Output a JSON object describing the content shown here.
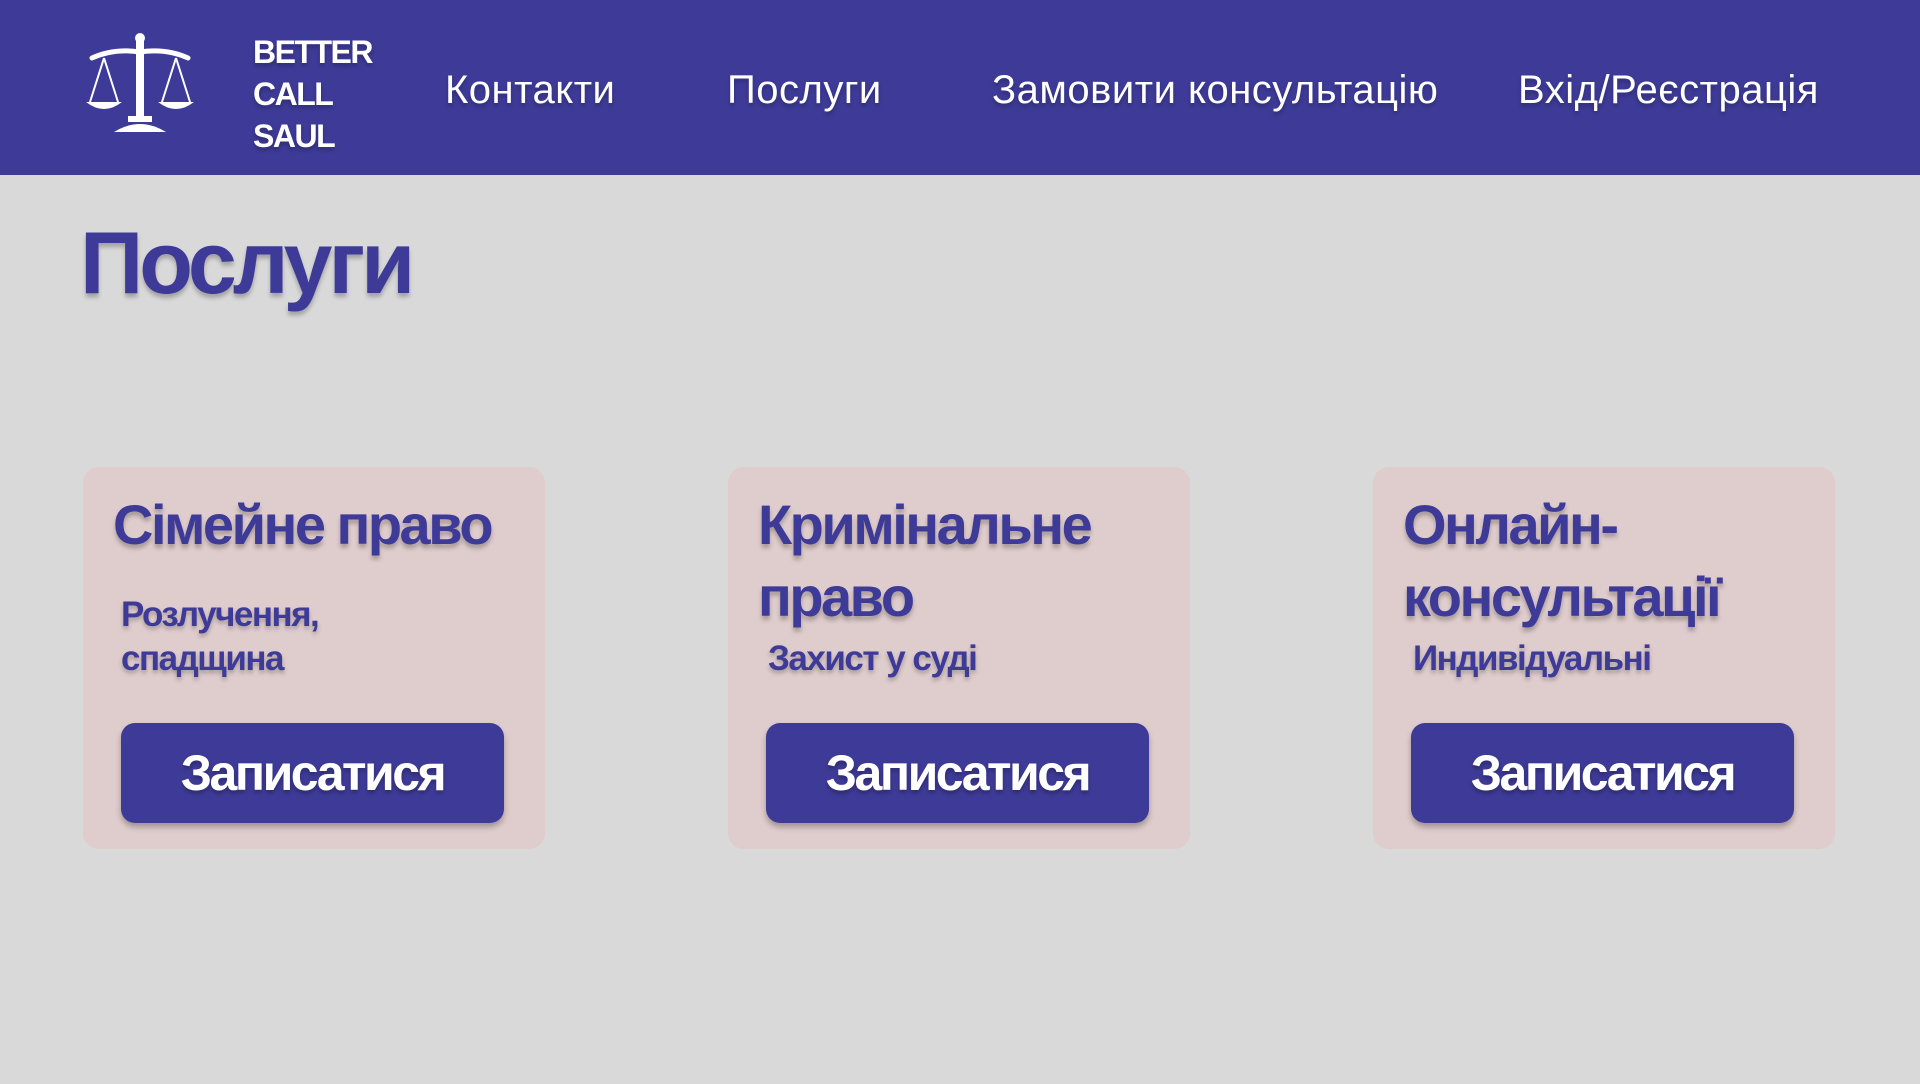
{
  "brand": {
    "lines": [
      "BETTER",
      "CALL",
      "SAUL"
    ],
    "logo_icon": "scales-of-justice-icon"
  },
  "nav": {
    "contacts": "Контакти",
    "services": "Послуги",
    "order_consultation": "Замовити консультацію",
    "login_register": "Вхід/Реєстрація"
  },
  "page": {
    "title": "Послуги"
  },
  "cards": [
    {
      "title_lines": [
        "Сімейне право"
      ],
      "description_lines": [
        "Розлучення,",
        "спадщина"
      ],
      "button_label": "Записатися"
    },
    {
      "title_lines": [
        "Кримінальне",
        "право"
      ],
      "description_lines": [
        "Захист у суді"
      ],
      "button_label": "Записатися"
    },
    {
      "title_lines": [
        "Онлайн-",
        "консультації"
      ],
      "description_lines": [
        "Индивідуальні"
      ],
      "button_label": "Записатися"
    }
  ],
  "colors": {
    "accent": "#3e3b98",
    "background": "#d9d9d9",
    "card_background": "#dfcccc",
    "text_on_accent": "#ffffff"
  }
}
